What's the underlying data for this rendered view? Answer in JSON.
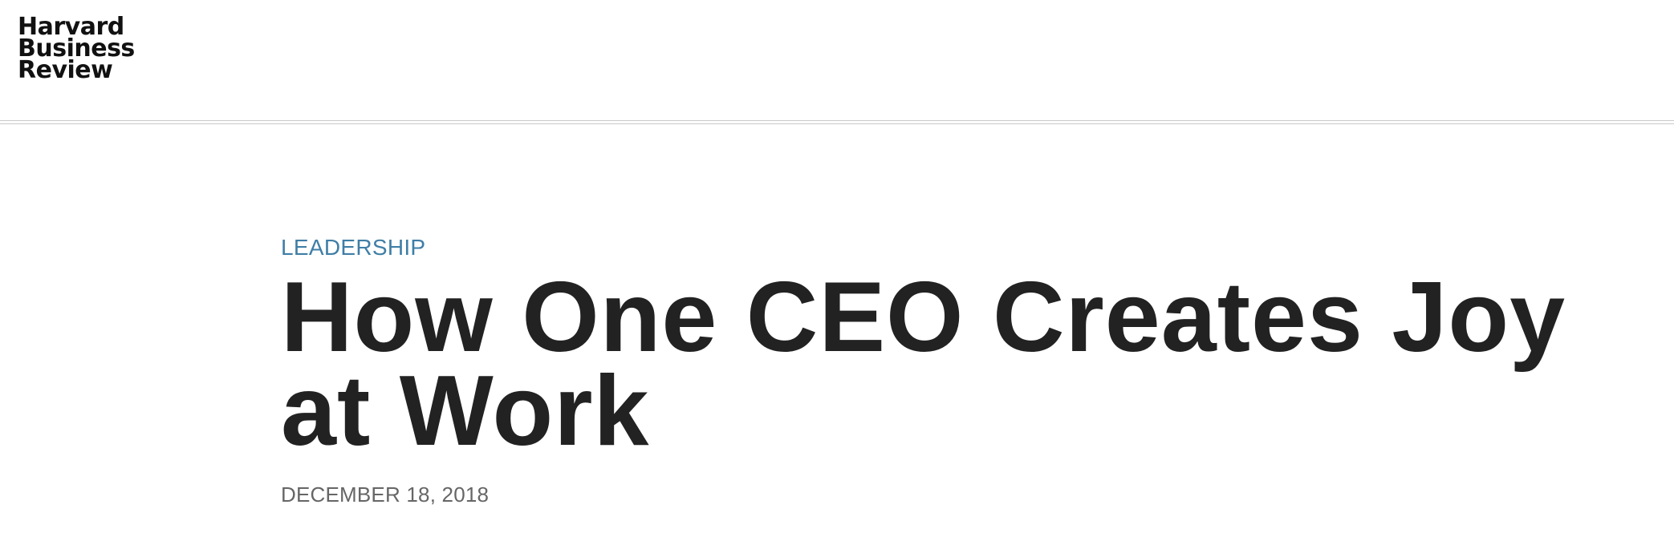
{
  "site": {
    "logo_lines": [
      "Harvard",
      "Business",
      "Review"
    ]
  },
  "article": {
    "topic": "LEADERSHIP",
    "title_lines": [
      "How One CEO Creates Joy",
      "at Work"
    ],
    "date": "DECEMBER 18, 2018"
  },
  "colors": {
    "topic": "#3f7ea6",
    "title": "#222222",
    "date": "#666666",
    "rule": "#c9c9c9"
  }
}
